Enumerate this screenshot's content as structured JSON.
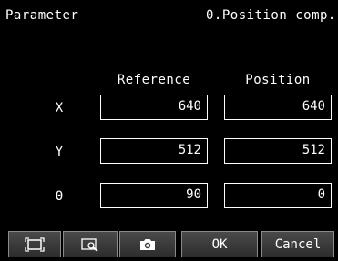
{
  "header": {
    "title": "Parameter",
    "subtitle": "0.Position comp."
  },
  "table": {
    "columns": [
      "Reference",
      "Position"
    ],
    "rows": [
      {
        "label": "X",
        "reference": "640",
        "position": "640"
      },
      {
        "label": "Y",
        "reference": "512",
        "position": "512"
      },
      {
        "label": "Θ",
        "reference": "90",
        "position": "0"
      }
    ]
  },
  "footer": {
    "icons": [
      "fit-screen-icon",
      "zoom-area-icon",
      "camera-icon"
    ],
    "ok_label": "OK",
    "cancel_label": "Cancel"
  },
  "colors": {
    "background": "#000000",
    "text": "#ffffff",
    "button": "#3a3a3a"
  }
}
